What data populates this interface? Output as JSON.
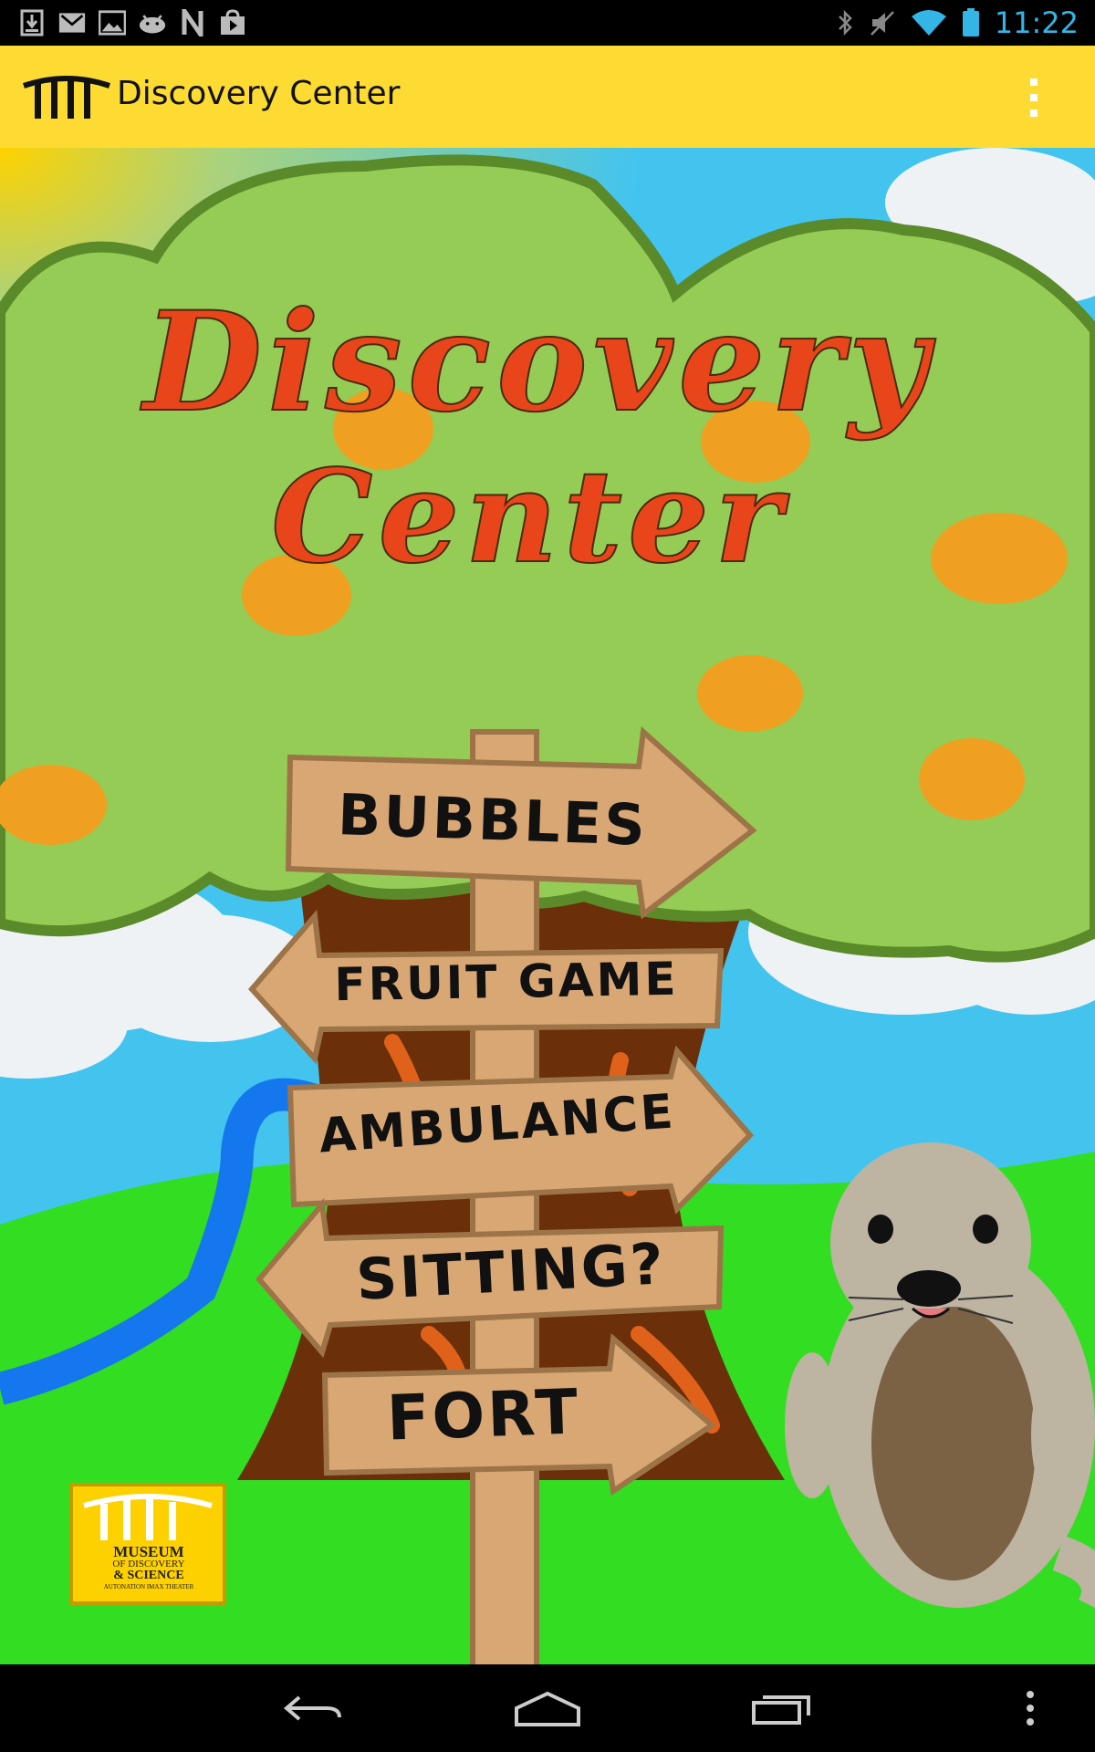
{
  "status_bar": {
    "time": "11:22",
    "left_icons": [
      "download-icon",
      "gmail-icon",
      "gallery-icon",
      "android-icon",
      "n-app-icon",
      "play-store-icon"
    ],
    "right_icons": [
      "bluetooth-icon",
      "mute-icon",
      "wifi-icon",
      "battery-icon"
    ]
  },
  "action_bar": {
    "title": "Discovery Center",
    "overflow_icon": "overflow-menu-icon",
    "background": "#fddb33"
  },
  "main": {
    "title_line1": "Discovery",
    "title_line2": "Center",
    "signs": [
      {
        "label": "BUBBLES",
        "direction": "right"
      },
      {
        "label": "FRUIT GAME",
        "direction": "left"
      },
      {
        "label": "AMBULANCE",
        "direction": "right"
      },
      {
        "label": "SITTING?",
        "direction": "left"
      },
      {
        "label": "FORT",
        "direction": "right"
      }
    ],
    "museum_logo": {
      "line1": "MUSEUM",
      "line2": "OF DISCOVERY",
      "line3": "& SCIENCE",
      "line4": "AUTONATION IMAX THEATER"
    }
  },
  "nav_bar": {
    "buttons": [
      "back-icon",
      "home-icon",
      "recent-apps-icon",
      "menu-icon"
    ]
  },
  "colors": {
    "title": "#e8461a",
    "sign": "#d8a774",
    "tree_leaves": "#94cc55",
    "grass": "#33dd22",
    "sky": "#43c4ef"
  }
}
